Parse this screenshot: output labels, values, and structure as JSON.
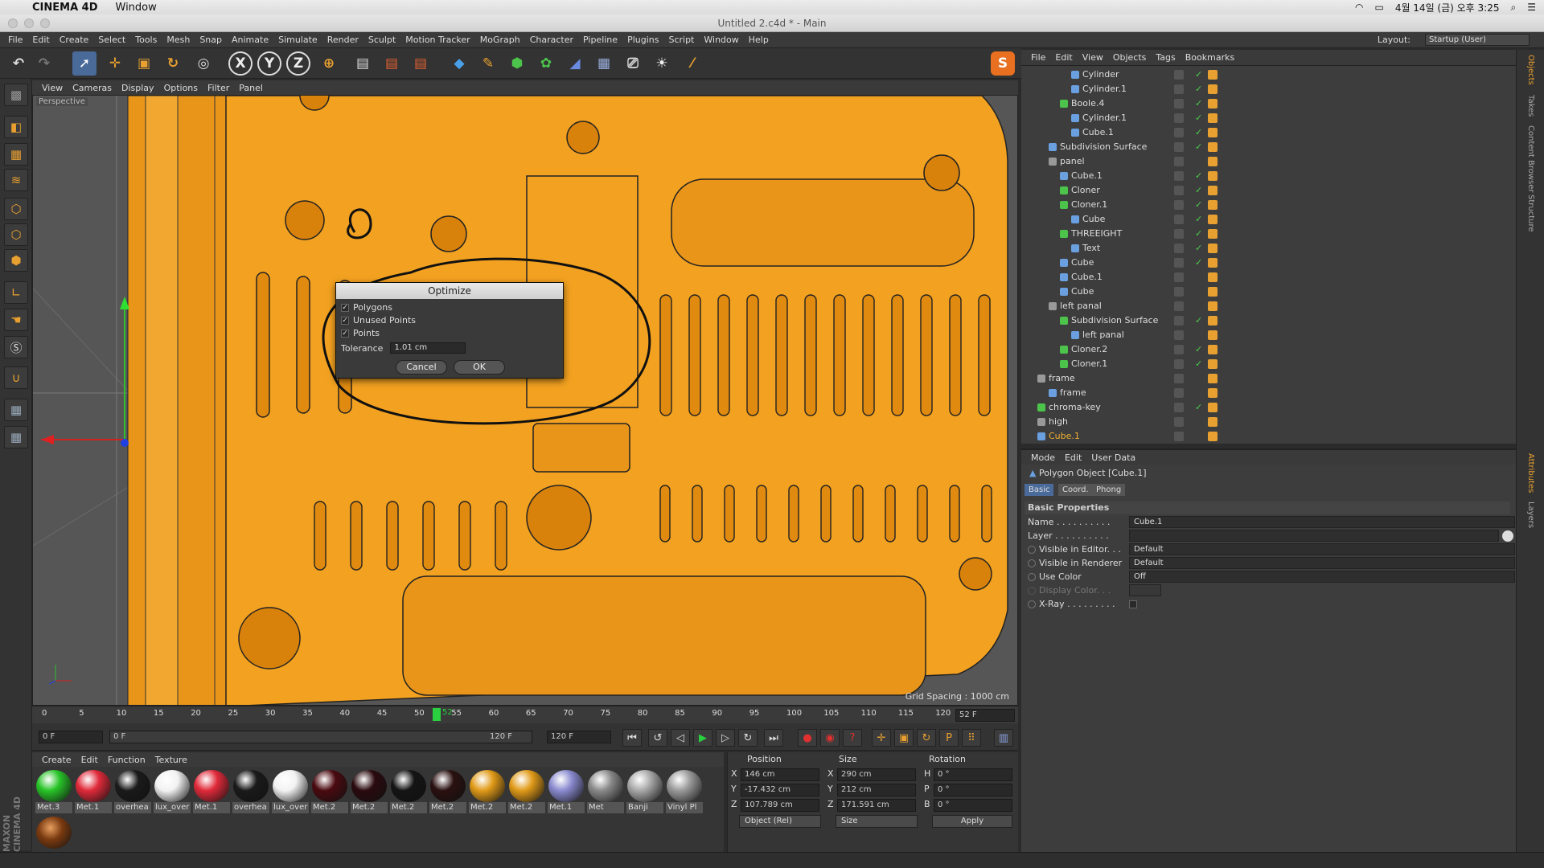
{
  "mac_menu": {
    "app": "CINEMA 4D",
    "window": "Window",
    "clock": "4월 14일 (금) 오후 3:25"
  },
  "window_title": "Untitled 2.c4d * - Main",
  "menu": [
    "File",
    "Edit",
    "Create",
    "Select",
    "Tools",
    "Mesh",
    "Snap",
    "Animate",
    "Simulate",
    "Render",
    "Sculpt",
    "Motion Tracker",
    "MoGraph",
    "Character",
    "Pipeline",
    "Plugins",
    "Script",
    "Window",
    "Help"
  ],
  "layout": {
    "label": "Layout:",
    "value": "Startup (User)"
  },
  "toolbar_axes": [
    "X",
    "Y",
    "Z"
  ],
  "viewport": {
    "menu": [
      "View",
      "Cameras",
      "Display",
      "Options",
      "Filter",
      "Panel"
    ],
    "label": "Perspective",
    "grid_spacing": "Grid Spacing : 1000 cm"
  },
  "dialog": {
    "title": "Optimize",
    "options": [
      {
        "label": "Polygons",
        "checked": true
      },
      {
        "label": "Unused Points",
        "checked": true
      },
      {
        "label": "Points",
        "checked": true
      }
    ],
    "tolerance_label": "Tolerance",
    "tolerance_value": "1.01 cm",
    "cancel": "Cancel",
    "ok": "OK"
  },
  "timeline": {
    "ticks": [
      "0",
      "5",
      "10",
      "15",
      "20",
      "25",
      "30",
      "35",
      "40",
      "45",
      "50",
      "55",
      "60",
      "65",
      "70",
      "75",
      "80",
      "85",
      "90",
      "95",
      "100",
      "105",
      "110",
      "115",
      "120"
    ],
    "current": "52",
    "current_frame": "52 F",
    "start": "0 F",
    "range_start": "0 F",
    "range_end": "120 F",
    "end": "120 F"
  },
  "materials": {
    "menu": [
      "Create",
      "Edit",
      "Function",
      "Texture"
    ],
    "items": [
      {
        "name": "Met.3",
        "color": "#28c428"
      },
      {
        "name": "Met.1",
        "color": "#e02a3a"
      },
      {
        "name": "overhea",
        "color": "#1a1a1a"
      },
      {
        "name": "lux_over",
        "color": "#f2f2f2"
      },
      {
        "name": "Met.1",
        "color": "#e02a3a"
      },
      {
        "name": "overhea",
        "color": "#1a1a1a"
      },
      {
        "name": "lux_over",
        "color": "#f2f2f2"
      },
      {
        "name": "Met.2",
        "color": "#4a0a10"
      },
      {
        "name": "Met.2",
        "color": "#2a0a0e"
      },
      {
        "name": "Met.2",
        "color": "#141414"
      },
      {
        "name": "Met.2",
        "color": "#2a1010"
      },
      {
        "name": "Met.2",
        "color": "#e09a18"
      },
      {
        "name": "Met.2",
        "color": "#e09a18"
      },
      {
        "name": "Met.1",
        "color": "#8a8ad0"
      },
      {
        "name": "Met",
        "color": "#8a8a8a"
      },
      {
        "name": "Banji",
        "color": "#a8a8a8"
      },
      {
        "name": "Vinyl Pl",
        "color": "#9a9a9a"
      }
    ],
    "extra_color": "#7a3a10"
  },
  "coords": {
    "headers": [
      "Position",
      "Size",
      "Rotation"
    ],
    "rows": [
      {
        "axis": "X",
        "pos": "146 cm",
        "size_axis": "X",
        "size": "290 cm",
        "rot_axis": "H",
        "rot": "0 °"
      },
      {
        "axis": "Y",
        "pos": "-17.432 cm",
        "size_axis": "Y",
        "size": "212 cm",
        "rot_axis": "P",
        "rot": "0 °"
      },
      {
        "axis": "Z",
        "pos": "107.789 cm",
        "size_axis": "Z",
        "size": "171.591 cm",
        "rot_axis": "B",
        "rot": "0 °"
      }
    ],
    "mode": "Object (Rel)",
    "size_mode": "Size",
    "apply": "Apply"
  },
  "objects": {
    "menu": [
      "File",
      "Edit",
      "View",
      "Objects",
      "Tags",
      "Bookmarks"
    ],
    "rows": [
      {
        "name": "Cylinder",
        "indent": 3,
        "icon": "#6aa0e0",
        "check": true
      },
      {
        "name": "Cylinder.1",
        "indent": 3,
        "icon": "#6aa0e0",
        "check": true
      },
      {
        "name": "Boole.4",
        "indent": 2,
        "icon": "#4cc44c",
        "check": true
      },
      {
        "name": "Cylinder.1",
        "indent": 3,
        "icon": "#6aa0e0",
        "check": true
      },
      {
        "name": "Cube.1",
        "indent": 3,
        "icon": "#6aa0e0",
        "check": true
      },
      {
        "name": "Subdivision Surface",
        "indent": 1,
        "icon": "#6aa0e0",
        "check": true
      },
      {
        "name": "panel",
        "indent": 1,
        "icon": "#999",
        "check": false
      },
      {
        "name": "Cube.1",
        "indent": 2,
        "icon": "#6aa0e0",
        "check": true
      },
      {
        "name": "Cloner",
        "indent": 2,
        "icon": "#4cc44c",
        "check": true
      },
      {
        "name": "Cloner.1",
        "indent": 2,
        "icon": "#4cc44c",
        "check": true
      },
      {
        "name": "Cube",
        "indent": 3,
        "icon": "#6aa0e0",
        "check": true
      },
      {
        "name": "THREEIGHT",
        "indent": 2,
        "icon": "#4cc44c",
        "check": true
      },
      {
        "name": "Text",
        "indent": 3,
        "icon": "#6aa0e0",
        "check": true
      },
      {
        "name": "Cube",
        "indent": 2,
        "icon": "#6aa0e0",
        "check": true
      },
      {
        "name": "Cube.1",
        "indent": 2,
        "icon": "#6aa0e0",
        "check": false
      },
      {
        "name": "Cube",
        "indent": 2,
        "icon": "#6aa0e0",
        "check": false
      },
      {
        "name": "left panal",
        "indent": 1,
        "icon": "#999",
        "check": false
      },
      {
        "name": "Subdivision Surface",
        "indent": 2,
        "icon": "#4cc44c",
        "check": true
      },
      {
        "name": "left panal",
        "indent": 3,
        "icon": "#6aa0e0",
        "check": false
      },
      {
        "name": "Cloner.2",
        "indent": 2,
        "icon": "#4cc44c",
        "check": true
      },
      {
        "name": "Cloner.1",
        "indent": 2,
        "icon": "#4cc44c",
        "check": true
      },
      {
        "name": "frame",
        "indent": 0,
        "icon": "#999",
        "check": false
      },
      {
        "name": "frame",
        "indent": 1,
        "icon": "#6aa0e0",
        "check": false
      },
      {
        "name": "chroma-key",
        "indent": 0,
        "icon": "#4cc44c",
        "check": true
      },
      {
        "name": "high",
        "indent": 0,
        "icon": "#999",
        "check": false
      },
      {
        "name": "Cube.1",
        "indent": 0,
        "icon": "#6aa0e0",
        "check": false,
        "selected": true
      }
    ]
  },
  "side_tabs": [
    "Objects",
    "Takes",
    "Content Browser",
    "Structure",
    "Attributes",
    "Layers"
  ],
  "attributes": {
    "menu": [
      "Mode",
      "Edit",
      "User Data"
    ],
    "object_title": "Polygon Object [Cube.1]",
    "tabs": [
      "Basic",
      "Coord.",
      "Phong"
    ],
    "section": "Basic Properties",
    "fields": [
      {
        "label": "Name . . . . . . . . . .",
        "value": "Cube.1"
      },
      {
        "label": "Layer . . . . . . . . . .",
        "value": ""
      },
      {
        "label": "Visible in Editor. . .",
        "value": "Default"
      },
      {
        "label": "Visible in Renderer",
        "value": "Default"
      },
      {
        "label": "Use Color",
        "value": "Off"
      },
      {
        "label": "Display Color. . .",
        "value": ""
      },
      {
        "label": "X-Ray . . . . . . . . .",
        "value": ""
      }
    ]
  },
  "branding": "MAXON CINEMA 4D"
}
